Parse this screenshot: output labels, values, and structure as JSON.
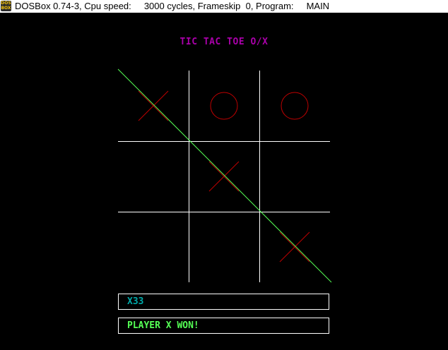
{
  "window": {
    "title": "DOSBox 0.74-3, Cpu speed:     3000 cycles, Frameskip  0, Program:     MAIN",
    "icon_name": "dosbox-icon",
    "icon_text_top": "DOS",
    "icon_text_bottom": "BOX",
    "minimize_glyph": "—",
    "maximize_glyph": "☐",
    "close_glyph": "✕"
  },
  "game": {
    "title": "TIC TAC TOE O/X",
    "title_color": "#aa00aa",
    "board": [
      [
        "X",
        "O",
        "O"
      ],
      [
        "",
        "X",
        ""
      ],
      [
        "",
        "",
        "X"
      ]
    ],
    "mark_color": "#c00000",
    "grid_color": "#ffffff",
    "win_line": {
      "from": "top-left",
      "to": "bottom-right",
      "color": "#55ff55"
    },
    "last_move": "X33",
    "last_move_color": "#00aaaa",
    "status": "PLAYER X WON!",
    "status_color": "#55ff55"
  }
}
